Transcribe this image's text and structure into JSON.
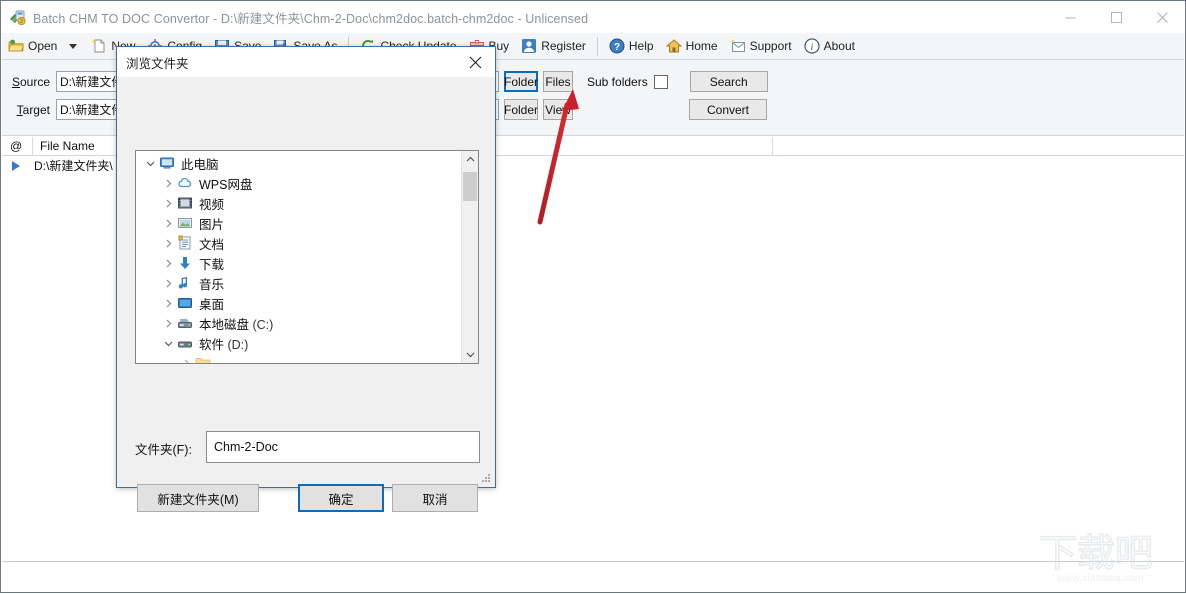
{
  "window": {
    "title": "Batch CHM TO DOC Convertor - D:\\新建文件夹\\Chm-2-Doc\\chm2doc.batch-chm2doc - Unlicensed",
    "icon": "app-icon",
    "controls": {
      "minimize": "minimize-icon",
      "maximize": "maximize-icon",
      "close": "close-icon"
    }
  },
  "toolbar": {
    "items": [
      {
        "label": "Open",
        "icon": "open-folder-icon"
      },
      {
        "label": "New",
        "icon": "new-document-icon"
      },
      {
        "label": "Config",
        "icon": "config-gear-icon"
      },
      {
        "label": "Save",
        "icon": "save-disk-icon"
      },
      {
        "label": "Save As",
        "icon": "save-as-icon"
      },
      {
        "label": "Check Update",
        "icon": "refresh-icon"
      },
      {
        "label": "Buy",
        "icon": "cart-icon"
      },
      {
        "label": "Register",
        "icon": "user-icon"
      },
      {
        "label": "Help",
        "icon": "help-question-icon"
      },
      {
        "label": "Home",
        "icon": "home-icon"
      },
      {
        "label": "Support",
        "icon": "mail-icon"
      },
      {
        "label": "About",
        "icon": "info-icon"
      }
    ],
    "dropdown_caret": "chevron-down-icon"
  },
  "paths": {
    "source": {
      "label_prefix": "S",
      "label": "ource",
      "value": "D:\\新建文件夹",
      "folder_button": "Folder",
      "files_button": "Files",
      "subfolders_label": "Sub folders",
      "subfolders_checked": false,
      "search_button": "Search"
    },
    "target": {
      "label_prefix": "T",
      "label": "arget",
      "value": "D:\\新建文件夹",
      "folder_button": "Folder",
      "view_button": "View",
      "convert_button": "Convert"
    }
  },
  "file_list": {
    "columns": [
      "@",
      "File Name"
    ],
    "rows": [
      {
        "marker": "play-marker",
        "file_name": "D:\\新建文件夹\\"
      }
    ]
  },
  "dialog": {
    "title": "浏览文件夹",
    "close_icon": "close-icon",
    "tree": [
      {
        "label": "此电脑",
        "suffix": "",
        "depth": 0,
        "expander": "expanded",
        "icon": "computer-icon"
      },
      {
        "label": "WPS网盘",
        "suffix": "",
        "depth": 1,
        "expander": "collapsed",
        "icon": "cloud-icon"
      },
      {
        "label": "视频",
        "suffix": "",
        "depth": 1,
        "expander": "collapsed",
        "icon": "video-icon"
      },
      {
        "label": "图片",
        "suffix": "",
        "depth": 1,
        "expander": "collapsed",
        "icon": "picture-icon"
      },
      {
        "label": "文档",
        "suffix": "",
        "depth": 1,
        "expander": "collapsed",
        "icon": "document-icon"
      },
      {
        "label": "下载",
        "suffix": "",
        "depth": 1,
        "expander": "collapsed",
        "icon": "download-icon"
      },
      {
        "label": "音乐",
        "suffix": "",
        "depth": 1,
        "expander": "collapsed",
        "icon": "music-icon"
      },
      {
        "label": "桌面",
        "suffix": "",
        "depth": 1,
        "expander": "collapsed",
        "icon": "desktop-icon"
      },
      {
        "label": "本地磁盘",
        "suffix": " (C:)",
        "depth": 1,
        "expander": "collapsed",
        "icon": "harddisk-icon"
      },
      {
        "label": "软件",
        "suffix": " (D:)",
        "depth": 1,
        "expander": "expanded",
        "icon": "harddisk-icon"
      },
      {
        "label": "",
        "suffix": "",
        "depth": 2,
        "expander": "collapsed",
        "icon": "folder-icon"
      }
    ],
    "scroll": {
      "up_icon": "chevron-up-icon",
      "down_icon": "chevron-down-icon"
    },
    "folder_name_label": "文件夹(F):",
    "folder_name_value": "Chm-2-Doc",
    "new_folder_button": "新建文件夹(M)",
    "ok_button": "确定",
    "cancel_button": "取消"
  },
  "annotation": {
    "arrow_color": "#c8232a",
    "points_to": "Folder"
  },
  "watermark": {
    "text": "下载吧",
    "url": "www.xiazaiba.com"
  }
}
